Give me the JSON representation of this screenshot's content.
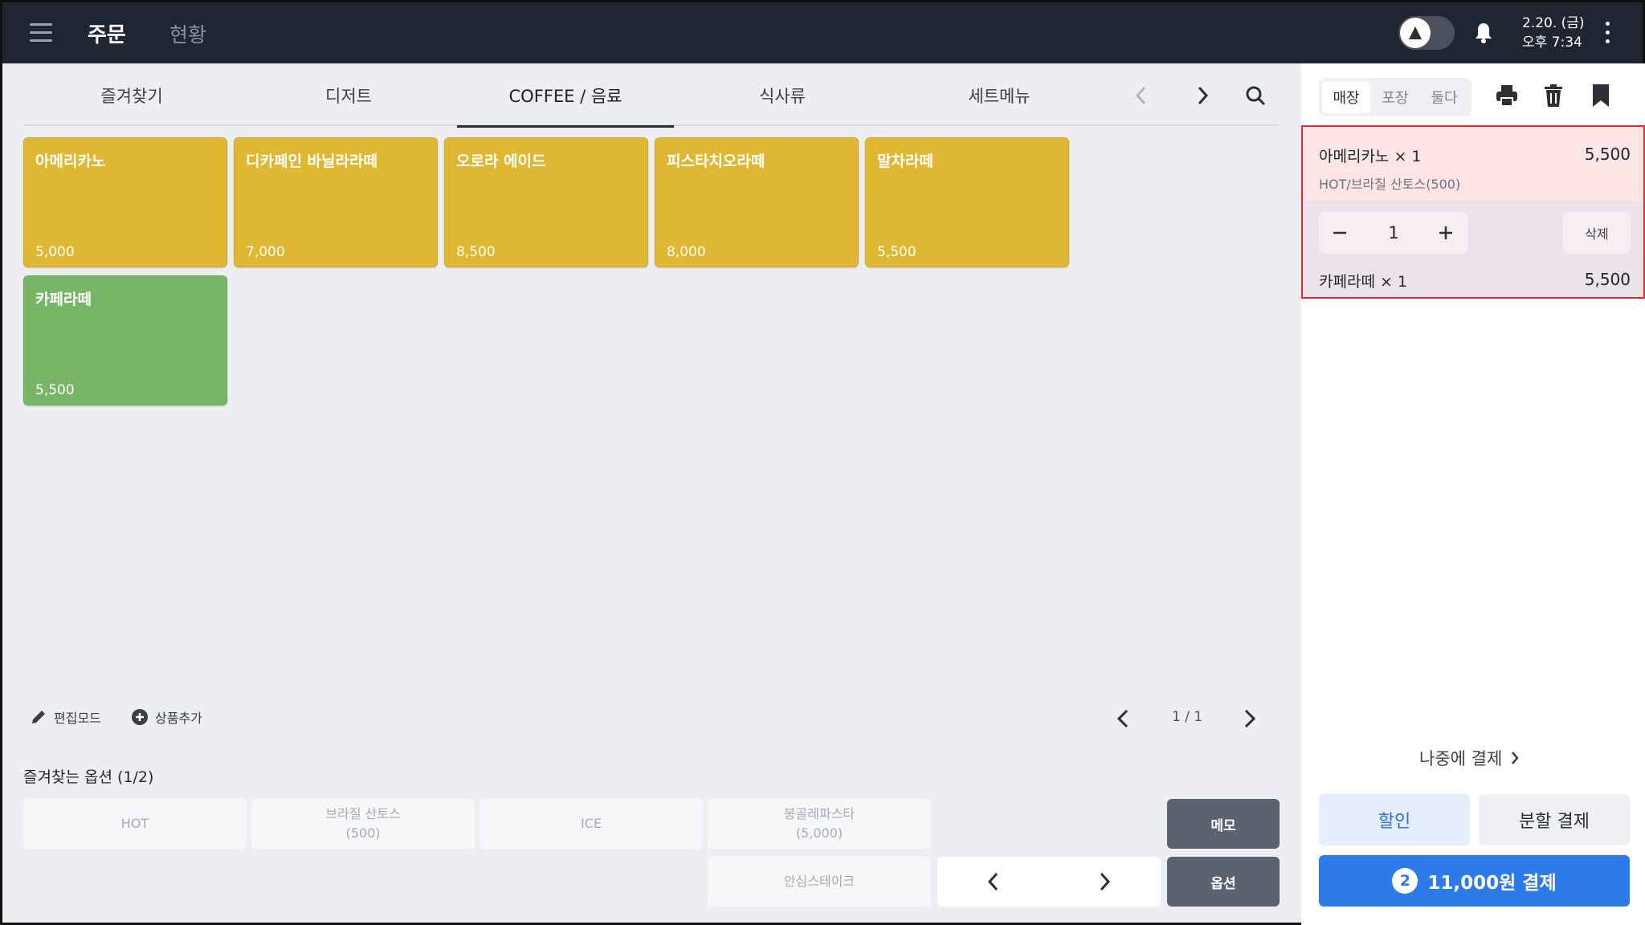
{
  "header": {
    "nav_main": "주문",
    "nav_sub": "현황",
    "date": "2.20. (금)",
    "time": "오후 7:34"
  },
  "tabs": [
    {
      "label": "즐겨찾기"
    },
    {
      "label": "디저트"
    },
    {
      "label": "COFFEE / 음료"
    },
    {
      "label": "식사류"
    },
    {
      "label": "세트메뉴"
    }
  ],
  "products": [
    {
      "name": "아메리카노",
      "price": "5,000"
    },
    {
      "name": "디카페인 바닐라라떼",
      "price": "7,000"
    },
    {
      "name": "오로라 에이드",
      "price": "8,500"
    },
    {
      "name": "피스타치오라떼",
      "price": "8,000"
    },
    {
      "name": "말차라떼",
      "price": "5,500"
    },
    {
      "name": "카페라떼",
      "price": "5,500"
    }
  ],
  "toolbar": {
    "edit_mode": "편집모드",
    "add_product": "상품추가",
    "page": "1 / 1"
  },
  "favorites": {
    "title": "즐겨찾는 옵션 (1/2)",
    "options": [
      {
        "line1": "HOT",
        "line2": ""
      },
      {
        "line1": "브라질 산토스",
        "line2": "(500)"
      },
      {
        "line1": "ICE",
        "line2": ""
      },
      {
        "line1": "봉골레파스타",
        "line2": "(5,000)"
      },
      {
        "line1": "안심스테이크",
        "line2": ""
      }
    ],
    "memo": "메모",
    "option": "옵션"
  },
  "panel": {
    "segments": [
      "매장",
      "포장",
      "둘다"
    ],
    "orders": [
      {
        "name": "아메리카노 × 1",
        "price": "5,500",
        "option": "HOT/브라질 산토스(500)",
        "qty": "1",
        "delete": "삭제"
      },
      {
        "name": "카페라떼 × 1",
        "price": "5,500"
      }
    ],
    "pay_later": "나중에 결제",
    "discount": "할인",
    "split": "분할 결제",
    "pay_count": "2",
    "pay_label": "11,000원 결제"
  },
  "colors": {
    "accent": "#2d7be8",
    "tile_yellow": "#e0b732",
    "tile_green": "#78b566",
    "highlight_border": "#dc2c35"
  }
}
